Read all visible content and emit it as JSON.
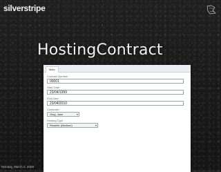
{
  "brand": {
    "logo_text": "silverstripe"
  },
  "slide": {
    "title": "HostingContract"
  },
  "form": {
    "tab_label": "Main",
    "fields": [
      {
        "label": "Contract Number",
        "value": "00001",
        "type": "text"
      },
      {
        "label": "Start Date",
        "value": "23/04/1999",
        "type": "text"
      },
      {
        "label": "End Date",
        "value": "23/04/2010",
        "type": "text"
      },
      {
        "label": "Customer",
        "value": "Ging, Jane",
        "type": "select"
      },
      {
        "label": "Hosting Type",
        "value": "Reseller (Medium)",
        "type": "select"
      }
    ]
  },
  "footer": {
    "date": "Monday, March 2, 2009"
  },
  "icons": {
    "select_arrow": "chevron-down-icon",
    "corner": "doodle-icon"
  }
}
